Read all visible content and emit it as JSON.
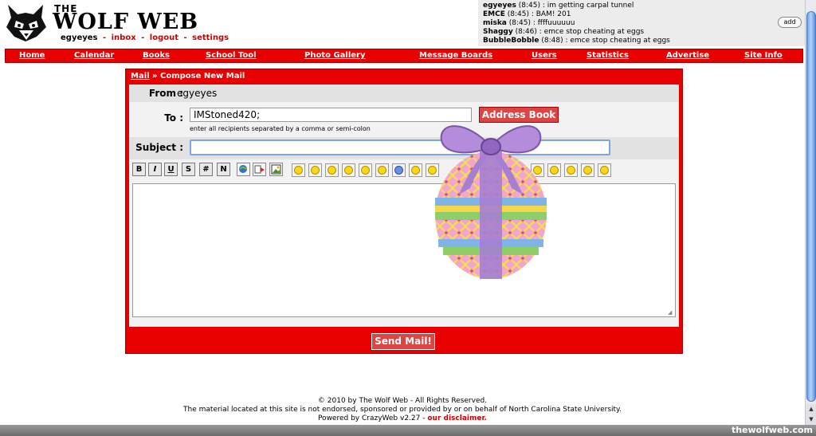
{
  "header": {
    "brand_the": "THE",
    "brand_name": "WOLF WEB",
    "username": "egyeyes",
    "links": [
      "inbox",
      "logout",
      "settings"
    ],
    "sep": "-"
  },
  "chat": {
    "lines": [
      {
        "user": "egyeyes",
        "time": "(8:45)",
        "msg": ": im getting carpal tunnel"
      },
      {
        "user": "EMCE",
        "time": "(8:45)",
        "msg": ": BAM! 201"
      },
      {
        "user": "miska",
        "time": "(8:45)",
        "msg": ": ffffuuuuuu"
      },
      {
        "user": "Shaggy",
        "time": "(8:46)",
        "msg": ": emce stop cheating at eggs"
      },
      {
        "user": "BubbleBobble",
        "time": "(8:48)",
        "msg": ": emce stop cheating at eggs"
      }
    ],
    "add_label": "add"
  },
  "nav": {
    "items": [
      "Home",
      "Calendar",
      "Books",
      "School Tool",
      "Photo Gallery",
      "Message Boards",
      "Users",
      "Statistics",
      "Advertise",
      "Site Info"
    ]
  },
  "mail": {
    "crumb_link": "Mail",
    "crumb_sep": "»",
    "crumb_page": "Compose New Mail",
    "from_label": "From :",
    "from_value": "egyeyes",
    "to_label": "To :",
    "to_value": "IMStoned420;",
    "to_hint": "enter all recipients separated by a comma or semi-colon",
    "address_book": "Address Book",
    "subject_label": "Subject :",
    "subject_value": "",
    "toolbar": {
      "bold": "B",
      "italic": "I",
      "underline": "U",
      "strike": "S",
      "hash": "#",
      "n": "N"
    },
    "send_label": "Send Mail!"
  },
  "footer": {
    "line1": "© 2010 by The Wolf Web - All Rights Reserved.",
    "line2": "The material located at this site is not endorsed, sponsored or provided by or on behalf of North Carolina State University.",
    "line3_prefix": "Powered by CrazyWeb v2.27 -",
    "disclaimer": "our disclaimer."
  },
  "watermark": "thewolfweb.com"
}
